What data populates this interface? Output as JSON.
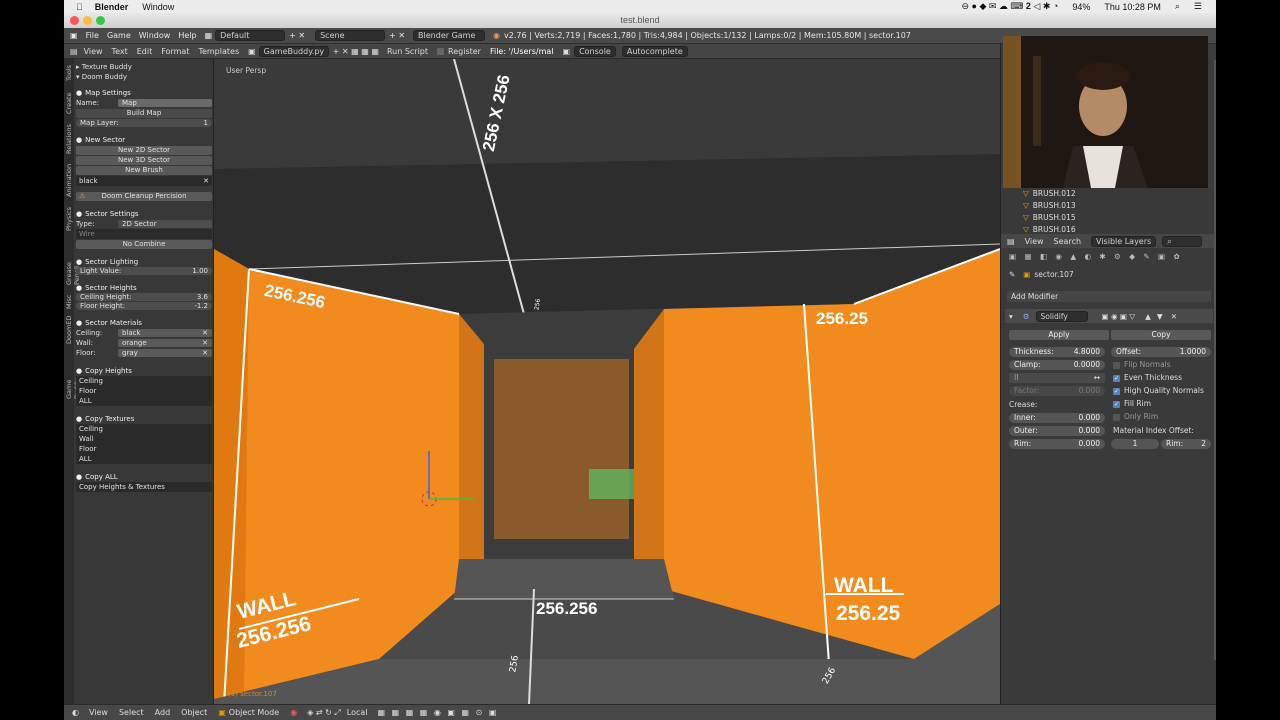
{
  "mac": {
    "app": "Blender",
    "menu": "Window",
    "time": "Thu 10:28 PM",
    "battery": "94%",
    "badge": "2"
  },
  "window_title": "test.blend",
  "info": {
    "menus": [
      "File",
      "Game",
      "Window",
      "Help"
    ],
    "layout": "Default",
    "scene": "Scene",
    "engine": "Blender Game",
    "stats": "v2.76 | Verts:2,719 | Faces:1,780 | Tris:4,984 | Objects:1/132 | Lamps:0/2 | Mem:105.80M | sector.107"
  },
  "text_header": {
    "items": [
      "View",
      "Text",
      "Edit",
      "Format",
      "Templates"
    ],
    "file": "GameBuddy.py",
    "run": "Run Script",
    "register": "Register",
    "path": "File: '/Users/mal",
    "console": "Console",
    "autocomplete": "Autocomplete"
  },
  "tabs": [
    "Tools",
    "Create",
    "Relations",
    "Animation",
    "Physics",
    "Grease Pencil",
    "Misc",
    "DoomED",
    "Game Buddy"
  ],
  "left": {
    "texture_buddy": "Texture Buddy",
    "doom_buddy": "Doom Buddy",
    "map_settings": "Map Settings",
    "name_label": "Name:",
    "name_value": "Map",
    "build_map": "Build Map",
    "map_layer_label": "Map Layer:",
    "map_layer_value": "1",
    "new_sector": "New Sector",
    "new_2d": "New 2D Sector",
    "new_3d": "New 3D Sector",
    "new_brush": "New Brush",
    "brush_mat": "black",
    "cleanup": "Doom Cleanup Percision",
    "sector_settings": "Sector Settings",
    "type_label": "Type:",
    "type_value": "2D Sector",
    "wire": "Wire",
    "no_combine": "No Combine",
    "sector_lighting": "Sector Lighting",
    "light_label": "Light Value:",
    "light_value": "1.00",
    "sector_heights": "Sector Heights",
    "ceiling_h_label": "Ceiling Height:",
    "ceiling_h_value": "3.6",
    "floor_h_label": "Floor Height:",
    "floor_h_value": "-1.2",
    "sector_materials": "Sector Materials",
    "ceiling_label": "Ceiling:",
    "ceiling_mat": "black",
    "wall_label": "Wall:",
    "wall_mat": "orange",
    "floor_label": "Floor:",
    "floor_mat": "gray",
    "copy_heights": "Copy Heights",
    "ch_items": [
      "Ceiling",
      "Floor",
      "ALL"
    ],
    "copy_textures": "Copy Textures",
    "ct_items": [
      "Ceiling",
      "Wall",
      "Floor",
      "ALL"
    ],
    "copy_all": "Copy ALL",
    "copy_all_item": "Copy Heights & Textures"
  },
  "viewport": {
    "persp": "User Persp",
    "obj": "(1) sector.107",
    "labels": {
      "ceil": "256 X 256",
      "wall_l": "256.256",
      "wall_r": "256.25",
      "floor": "256.256",
      "wall_word": "WALL",
      "wall_l2": "256.256",
      "wall_r2": "256.25",
      "small1": "256",
      "small2": "256",
      "small3": "256"
    }
  },
  "bottom": {
    "items": [
      "View",
      "Select",
      "Add",
      "Object"
    ],
    "mode": "Object Mode",
    "pivot": "Local"
  },
  "outliner": {
    "rows": [
      "BRUSH.012",
      "BRUSH.013",
      "BRUSH.015",
      "BRUSH.016"
    ]
  },
  "props_header": {
    "items": [
      "View",
      "Search",
      "Visible Layers"
    ]
  },
  "props": {
    "object": "sector.107",
    "add_modifier": "Add Modifier",
    "modifier": "Solidify",
    "apply": "Apply",
    "copy": "Copy",
    "thickness_label": "Thickness:",
    "thickness": "4.8000",
    "offset_label": "Offset:",
    "offset": "1.0000",
    "clamp_label": "Clamp:",
    "clamp": "0.0000",
    "flip": "Flip Normals",
    "even": "Even Thickness",
    "hq": "High Quality Normals",
    "factor_label": "Factor:",
    "factor": "0.000",
    "fill": "Fill Rim",
    "only": "Only Rim",
    "crease": "Crease:",
    "inner_label": "Inner:",
    "inner": "0.000",
    "outer_label": "Outer:",
    "outer": "0.000",
    "rim_label": "Rim:",
    "rim": "0.000",
    "mio": "Material Index Offset:",
    "mio_val": "1",
    "mio_rim_label": "Rim:",
    "mio_rim": "2"
  },
  "colors": {
    "orange": "#f28b1e",
    "accent": "#5680c2"
  }
}
